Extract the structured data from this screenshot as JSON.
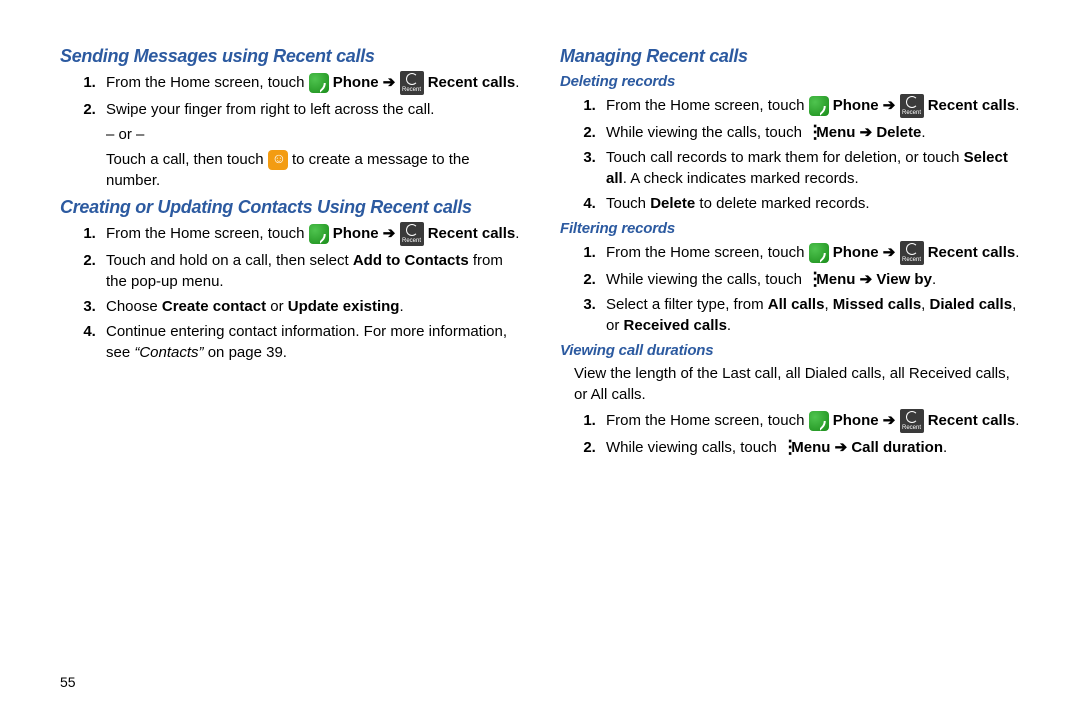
{
  "page_number": "55",
  "left": {
    "h1": "Sending Messages using Recent calls",
    "s1": [
      {
        "pre": "From the Home screen, touch ",
        "phone": "Phone",
        "recent": "Recent calls",
        "post": "."
      },
      {
        "text": "Swipe your finger from right to left across the call."
      }
    ],
    "or": "– or –",
    "ortext_pre": "Touch a call, then touch ",
    "ortext_post": " to create a message to the number.",
    "h2": "Creating or Updating Contacts Using Recent calls",
    "s2": [
      {
        "pre": "From the Home screen, touch ",
        "phone": "Phone",
        "recent": "Recent calls",
        "post": "."
      },
      {
        "pre": "Touch and hold on a call, then select ",
        "b": "Add to Contacts",
        "post": " from the pop-up menu."
      },
      {
        "pre": "Choose ",
        "b": "Create contact",
        "mid": " or ",
        "b2": "Update existing",
        "post": "."
      },
      {
        "pre": "Continue entering contact information. For more information, see ",
        "ital": "“Contacts”",
        "post": " on page 39."
      }
    ]
  },
  "right": {
    "h1": "Managing Recent calls",
    "sub1": "Deleting records",
    "d1": [
      {
        "pre": "From the Home screen, touch ",
        "phone": "Phone",
        "recent": "Recent calls",
        "post": "."
      },
      {
        "pre": "While viewing the calls, touch ",
        "menu": "Menu",
        "b2": "Delete",
        "post": "."
      },
      {
        "pre": "Touch call records to mark them for deletion, or touch ",
        "b": "Select all",
        "post": ". A check indicates marked records."
      },
      {
        "pre": "Touch ",
        "b": "Delete",
        "post": " to delete marked records."
      }
    ],
    "sub2": "Filtering records",
    "d2": [
      {
        "pre": "From the Home screen, touch ",
        "phone": "Phone",
        "recent": "Recent calls",
        "post": "."
      },
      {
        "pre": "While viewing the calls, touch ",
        "menu": "Menu",
        "b2": "View by",
        "post": "."
      },
      {
        "pre": "Select a filter type, from ",
        "b": "All calls",
        "mid": ", ",
        "b2": "Missed calls",
        "mid2": ", ",
        "b3": "Dialed calls",
        "mid3": ", or ",
        "b4": "Received calls",
        "post": "."
      }
    ],
    "sub3": "Viewing call durations",
    "intro3": "View the length of the Last call, all Dialed calls, all Received calls, or All calls.",
    "d3": [
      {
        "pre": "From the Home screen, touch ",
        "phone": "Phone",
        "recent": "Recent calls",
        "post": "."
      },
      {
        "pre": "While viewing calls, touch ",
        "menu": "Menu",
        "b2": "Call duration",
        "post": "."
      }
    ]
  }
}
